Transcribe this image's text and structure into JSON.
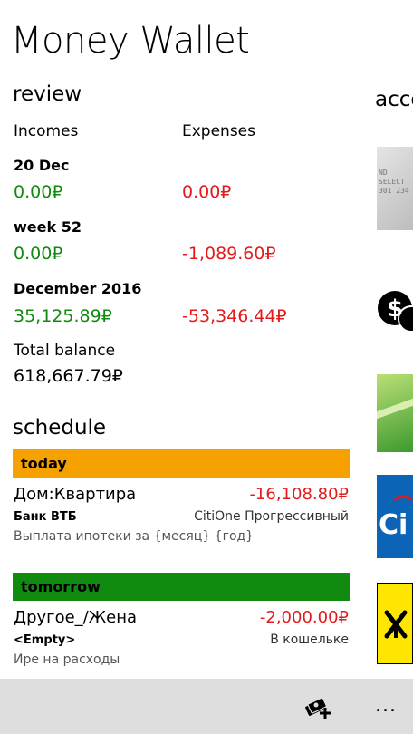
{
  "app": {
    "title": "Money Wallet"
  },
  "review": {
    "title": "review",
    "incomes_label": "Incomes",
    "expenses_label": "Expenses",
    "periods": [
      {
        "label": "20 Dec",
        "income": "0.00₽",
        "expense": "0.00₽"
      },
      {
        "label": "week 52",
        "income": "0.00₽",
        "expense": "-1,089.60₽"
      },
      {
        "label": "December 2016",
        "income": "35,125.89₽",
        "expense": "-53,346.44₽"
      }
    ],
    "total_label": "Total balance",
    "total_value": "618,667.79₽"
  },
  "accounts": {
    "title": "acco",
    "card_text_line1": "ND",
    "card_text_line2": "SELECT",
    "card_text_line3": "301 234"
  },
  "schedule": {
    "title": "schedule",
    "groups": [
      {
        "header": "today",
        "color": "#f5a100",
        "item": {
          "name": "Дом:Квартира",
          "amount": "-16,108.80₽",
          "account": "Банк ВТБ",
          "target_account": "CitiOne Прогрессивный",
          "note": "Выплата ипотеки за {месяц} {год}"
        }
      },
      {
        "header": "tomorrow",
        "color": "#118a10",
        "item": {
          "name": "Другое_/Жена",
          "amount": "-2,000.00₽",
          "account": "<Empty>",
          "target_account": "В кошельке",
          "note": "Ире на расходы"
        }
      }
    ]
  },
  "app_bar": {
    "add_icon": "money-add-icon",
    "more_label": "..."
  },
  "colors": {
    "income": "#118a10",
    "expense": "#e31a1c",
    "app_bar": "#dedede"
  }
}
